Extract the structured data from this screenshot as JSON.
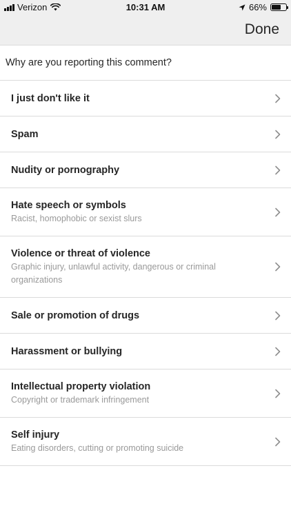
{
  "status_bar": {
    "carrier": "Verizon",
    "time": "10:31 AM",
    "battery_percent": "66%",
    "battery_level": 0.66
  },
  "header": {
    "done_label": "Done"
  },
  "prompt": "Why are you reporting this comment?",
  "options": [
    {
      "title": "I just don't like it",
      "subtitle": ""
    },
    {
      "title": "Spam",
      "subtitle": ""
    },
    {
      "title": "Nudity or pornography",
      "subtitle": ""
    },
    {
      "title": "Hate speech or symbols",
      "subtitle": "Racist, homophobic or sexist slurs"
    },
    {
      "title": "Violence or threat of violence",
      "subtitle": "Graphic injury, unlawful activity, dangerous or criminal organizations"
    },
    {
      "title": "Sale or promotion of drugs",
      "subtitle": ""
    },
    {
      "title": "Harassment or bullying",
      "subtitle": ""
    },
    {
      "title": "Intellectual property violation",
      "subtitle": "Copyright or trademark infringement"
    },
    {
      "title": "Self injury",
      "subtitle": "Eating disorders, cutting or promoting suicide"
    }
  ],
  "icons": {
    "signal": "cellular-signal-icon",
    "wifi": "wifi-icon",
    "location": "location-arrow-icon",
    "battery": "battery-icon",
    "chevron": "chevron-right-icon"
  }
}
